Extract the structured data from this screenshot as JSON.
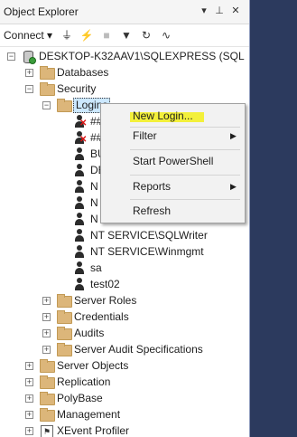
{
  "window": {
    "title": "Object Explorer",
    "pin_icon": "pin-icon",
    "close_icon": "close-icon"
  },
  "toolbar": {
    "connect_label": "Connect",
    "connect_arrow": "▾",
    "buttons": [
      "connect-icon",
      "disconnect-icon",
      "stop-icon",
      "filter-icon",
      "refresh-icon",
      "activity-monitor-icon"
    ]
  },
  "tree": {
    "server": "DESKTOP-K32AAV1\\SQLEXPRESS (SQL",
    "databases": "Databases",
    "security": "Security",
    "logins": "Logins",
    "login_items": [
      "##",
      "##",
      "BU",
      "DE",
      "N",
      "N",
      "N",
      "NT SERVICE\\SQLWriter",
      "NT SERVICE\\Winmgmt",
      "sa",
      "test02"
    ],
    "security_children": [
      "Server Roles",
      "Credentials",
      "Audits",
      "Server Audit Specifications"
    ],
    "root_children": [
      "Server Objects",
      "Replication",
      "PolyBase",
      "Management",
      "XEvent Profiler"
    ]
  },
  "context_menu": {
    "items": [
      {
        "label": "New Login...",
        "submenu": false
      },
      {
        "label": "Filter",
        "submenu": true
      },
      {
        "label": "Start PowerShell",
        "submenu": false
      },
      {
        "label": "Reports",
        "submenu": true
      },
      {
        "label": "Refresh",
        "submenu": false
      }
    ],
    "highlight_color": "#f3f03a"
  },
  "colors": {
    "selection": "#cce8ff",
    "background_outside": "#2c3a5e",
    "folder": "#dcb67a"
  }
}
